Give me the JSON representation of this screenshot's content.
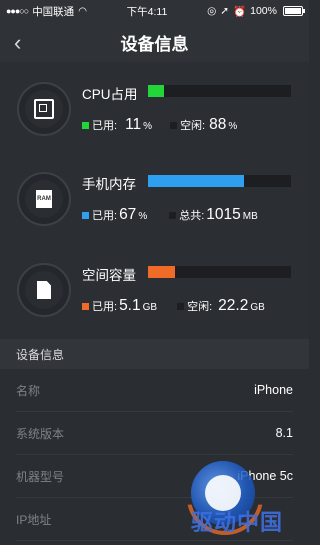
{
  "status_bar": {
    "signal_dots": "●●●○○",
    "carrier": "中国联通",
    "wifi_icon": "wifi-icon",
    "time": "下午4:11",
    "battery_pct": "100%"
  },
  "nav": {
    "back_icon": "chevron-left-icon",
    "title": "设备信息"
  },
  "cpu": {
    "label": "CPU占用",
    "bar_fill": 0.11,
    "bar_color": "#22d639",
    "used_label": "已用:",
    "used_value": "11",
    "used_unit": "%",
    "free_label": "空闲:",
    "free_value": "88",
    "free_unit": "%"
  },
  "memory": {
    "label": "手机内存",
    "bar_fill": 0.67,
    "bar_color": "#2f9ff0",
    "used_label": "已用:",
    "used_value": "67",
    "used_unit": "%",
    "total_label": "总共:",
    "total_value": "1015",
    "total_unit": "MB"
  },
  "storage": {
    "label": "空间容量",
    "bar_fill": 0.19,
    "bar_color": "#f06a28",
    "used_label": "已用:",
    "used_value": "5.1",
    "used_unit": "GB",
    "free_label": "空闲:",
    "free_value": "22.2",
    "free_unit": "GB"
  },
  "section": {
    "title": "设备信息"
  },
  "info": [
    {
      "key": "名称",
      "value": "iPhone"
    },
    {
      "key": "系统版本",
      "value": "8.1"
    },
    {
      "key": "机器型号",
      "value": "iPhone 5c"
    },
    {
      "key": "IP地址",
      "value": ""
    }
  ],
  "watermark": {
    "text": "驱动中国"
  }
}
